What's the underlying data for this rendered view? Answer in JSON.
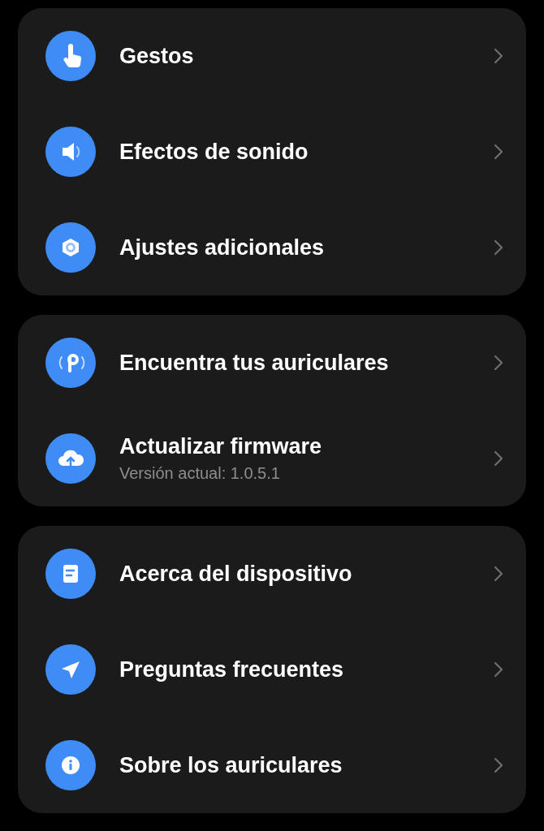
{
  "sections": [
    {
      "items": [
        {
          "title": "Gestos"
        },
        {
          "title": "Efectos de sonido"
        },
        {
          "title": "Ajustes adicionales"
        }
      ]
    },
    {
      "items": [
        {
          "title": "Encuentra tus auriculares"
        },
        {
          "title": "Actualizar firmware",
          "subtitle": "Versión actual: 1.0.5.1"
        }
      ]
    },
    {
      "items": [
        {
          "title": "Acerca del dispositivo"
        },
        {
          "title": "Preguntas frecuentes"
        },
        {
          "title": "Sobre los auriculares"
        }
      ]
    }
  ]
}
